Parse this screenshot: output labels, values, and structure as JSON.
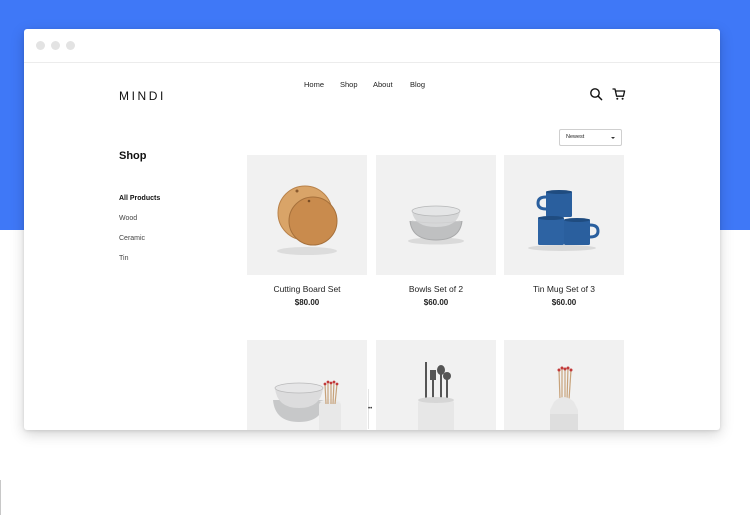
{
  "brand": {
    "logo": "MINDI"
  },
  "nav": {
    "items": [
      "Home",
      "Shop",
      "About",
      "Blog"
    ]
  },
  "icons": {
    "search": "search-icon",
    "cart": "cart-icon"
  },
  "sidebar": {
    "title": "Shop",
    "categories": [
      "All Products",
      "Wood",
      "Ceramic",
      "Tin"
    ],
    "active": "All Products"
  },
  "sort": {
    "selected": "Newest"
  },
  "products": [
    {
      "name": "Cutting Board Set",
      "price": "$80.00"
    },
    {
      "name": "Bowls Set of 2",
      "price": "$60.00"
    },
    {
      "name": "Tin Mug Set of 3",
      "price": "$60.00"
    },
    {
      "name": "",
      "price": ""
    },
    {
      "name": "",
      "price": ""
    },
    {
      "name": "",
      "price": ""
    }
  ],
  "colors": {
    "background_accent": "#3f78f7",
    "tile_bg": "#f1f1f1",
    "mug_blue": "#2a5f9e",
    "wood": "#c98b4d"
  }
}
